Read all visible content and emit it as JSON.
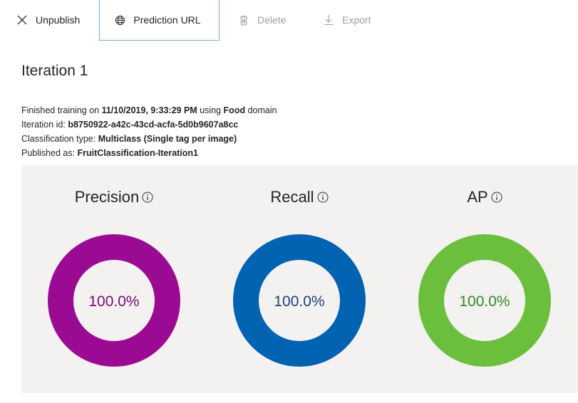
{
  "toolbar": {
    "unpublish_label": "Unpublish",
    "prediction_url_label": "Prediction URL",
    "delete_label": "Delete",
    "export_label": "Export"
  },
  "iteration": {
    "title": "Iteration 1",
    "finished_prefix": "Finished training on ",
    "finished_datetime": "11/10/2019, 9:33:29 PM",
    "finished_using": " using ",
    "domain_name": "Food",
    "finished_suffix": " domain",
    "id_label": "Iteration id: ",
    "id_value": "b8750922-a42c-43cd-acfa-5d0b9607a8cc",
    "classification_label": "Classification type: ",
    "classification_value": "Multiclass (Single tag per image)",
    "published_label": "Published as: ",
    "published_value": "FruitClassification-Iteration1"
  },
  "metrics": [
    {
      "name": "Precision",
      "display": "100.0%",
      "value": 100.0,
      "color": "#9b0a92",
      "text_color": "#7a0a73"
    },
    {
      "name": "Recall",
      "display": "100.0%",
      "value": 100.0,
      "color": "#0063b1",
      "text_color": "#1f3f7a"
    },
    {
      "name": "AP",
      "display": "100.0%",
      "value": 100.0,
      "color": "#6bbf3c",
      "text_color": "#2f8a22"
    }
  ],
  "icons": {
    "unpublish": "close-icon",
    "prediction_url": "globe-icon",
    "delete": "trash-icon",
    "export": "download-icon",
    "info": "info-icon"
  }
}
